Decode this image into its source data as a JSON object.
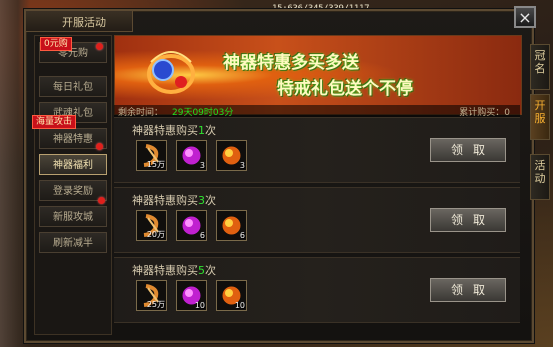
{
  "hud": {
    "coords": "15:636/345/339/1117"
  },
  "panel": {
    "title": "开服活动",
    "close_icon": "×"
  },
  "menu": {
    "items": [
      {
        "label": "零元购",
        "active": false
      },
      {
        "label": "每日礼包",
        "active": false
      },
      {
        "label": "武魂礼包",
        "active": false
      },
      {
        "label": "神器特惠",
        "active": false
      },
      {
        "label": "神器福利",
        "active": true
      },
      {
        "label": "登录奖励",
        "active": false
      },
      {
        "label": "新服攻城",
        "active": false
      },
      {
        "label": "刷新减半",
        "active": false
      }
    ],
    "badge_top": "0元购",
    "badge_mid": "海量攻击"
  },
  "banner": {
    "line1": "神器特惠多买多送",
    "line2": "特戒礼包送个不停",
    "time_label": "剩余时间：",
    "time_value": "29天09时03分",
    "count_label": "累计购买：0"
  },
  "rows": [
    {
      "prefix": "神器特惠购买",
      "num": "1",
      "suffix": "次",
      "claim": "领取",
      "items": [
        {
          "icon": "scroll-icon",
          "qty": "15万"
        },
        {
          "icon": "purple-orb-icon",
          "qty": "3"
        },
        {
          "icon": "orange-orb-icon",
          "qty": "3"
        }
      ]
    },
    {
      "prefix": "神器特惠购买",
      "num": "3",
      "suffix": "次",
      "claim": "领取",
      "items": [
        {
          "icon": "scroll-icon",
          "qty": "20万"
        },
        {
          "icon": "purple-orb-icon",
          "qty": "6"
        },
        {
          "icon": "orange-orb-icon",
          "qty": "6"
        }
      ]
    },
    {
      "prefix": "神器特惠购买",
      "num": "5",
      "suffix": "次",
      "claim": "领取",
      "items": [
        {
          "icon": "scroll-icon",
          "qty": "25万"
        },
        {
          "icon": "purple-orb-icon",
          "qty": "10"
        },
        {
          "icon": "orange-orb-icon",
          "qty": "10"
        }
      ]
    }
  ],
  "side_tabs": [
    {
      "label": "冠名",
      "active": false
    },
    {
      "label": "开服",
      "active": true
    },
    {
      "label": "活动",
      "active": false
    }
  ],
  "colors": {
    "accent_green": "#30e030",
    "badge_red": "#c8101a",
    "active_tab": "#f8b030"
  }
}
